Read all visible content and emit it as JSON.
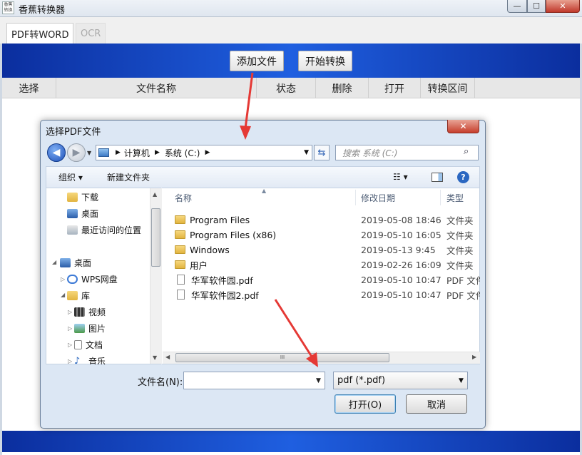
{
  "window": {
    "title": "香蕉转换器",
    "logo_text": "香蕉转换",
    "min": "—",
    "max": "☐",
    "close": "✕"
  },
  "tabs": [
    {
      "label": "PDF转WORD",
      "active": true
    },
    {
      "label": "OCR",
      "active": false
    }
  ],
  "toolbar": {
    "add_file": "添加文件",
    "start_convert": "开始转换"
  },
  "table_headers": [
    "选择",
    "文件名称",
    "状态",
    "删除",
    "打开",
    "转换区间"
  ],
  "dialog": {
    "title": "选择PDF文件",
    "close": "✕",
    "breadcrumb": [
      "计算机",
      "系统 (C:)"
    ],
    "search_placeholder": "搜索 系统 (C:)",
    "organize": "组织 ▾",
    "new_folder": "新建文件夹",
    "nav_items": [
      {
        "label": "下载",
        "icon": "download-folder-icon"
      },
      {
        "label": "桌面",
        "icon": "desktop-icon"
      },
      {
        "label": "最近访问的位置",
        "icon": "recent-places-icon"
      },
      {
        "label": "桌面",
        "icon": "desktop-icon"
      },
      {
        "label": "WPS网盘",
        "icon": "cloud-icon"
      },
      {
        "label": "库",
        "icon": "library-icon"
      },
      {
        "label": "视频",
        "icon": "video-icon"
      },
      {
        "label": "图片",
        "icon": "picture-icon"
      },
      {
        "label": "文档",
        "icon": "document-icon"
      },
      {
        "label": "音乐",
        "icon": "music-icon"
      }
    ],
    "columns": {
      "name": "名称",
      "date": "修改日期",
      "type": "类型"
    },
    "files": [
      {
        "name": "Program Files",
        "date": "2019-05-08 18:46",
        "type": "文件夹",
        "kind": "folder"
      },
      {
        "name": "Program Files (x86)",
        "date": "2019-05-10 16:05",
        "type": "文件夹",
        "kind": "folder"
      },
      {
        "name": "Windows",
        "date": "2019-05-13 9:45",
        "type": "文件夹",
        "kind": "folder"
      },
      {
        "name": "用户",
        "date": "2019-02-26 16:09",
        "type": "文件夹",
        "kind": "folder"
      },
      {
        "name": "华军软件园.pdf",
        "date": "2019-05-10 10:47",
        "type": "PDF 文件",
        "kind": "pdf"
      },
      {
        "name": "华军软件园2.pdf",
        "date": "2019-05-10 10:47",
        "type": "PDF 文件",
        "kind": "pdf"
      }
    ],
    "filename_label": "文件名(N):",
    "filename_value": "",
    "filter": "pdf (*.pdf)",
    "open": "打开(O)",
    "cancel": "取消",
    "hscroll_grip": "III"
  },
  "colors": {
    "band_blue": "#1f5fe0",
    "annotation_arrow": "#e53935"
  }
}
